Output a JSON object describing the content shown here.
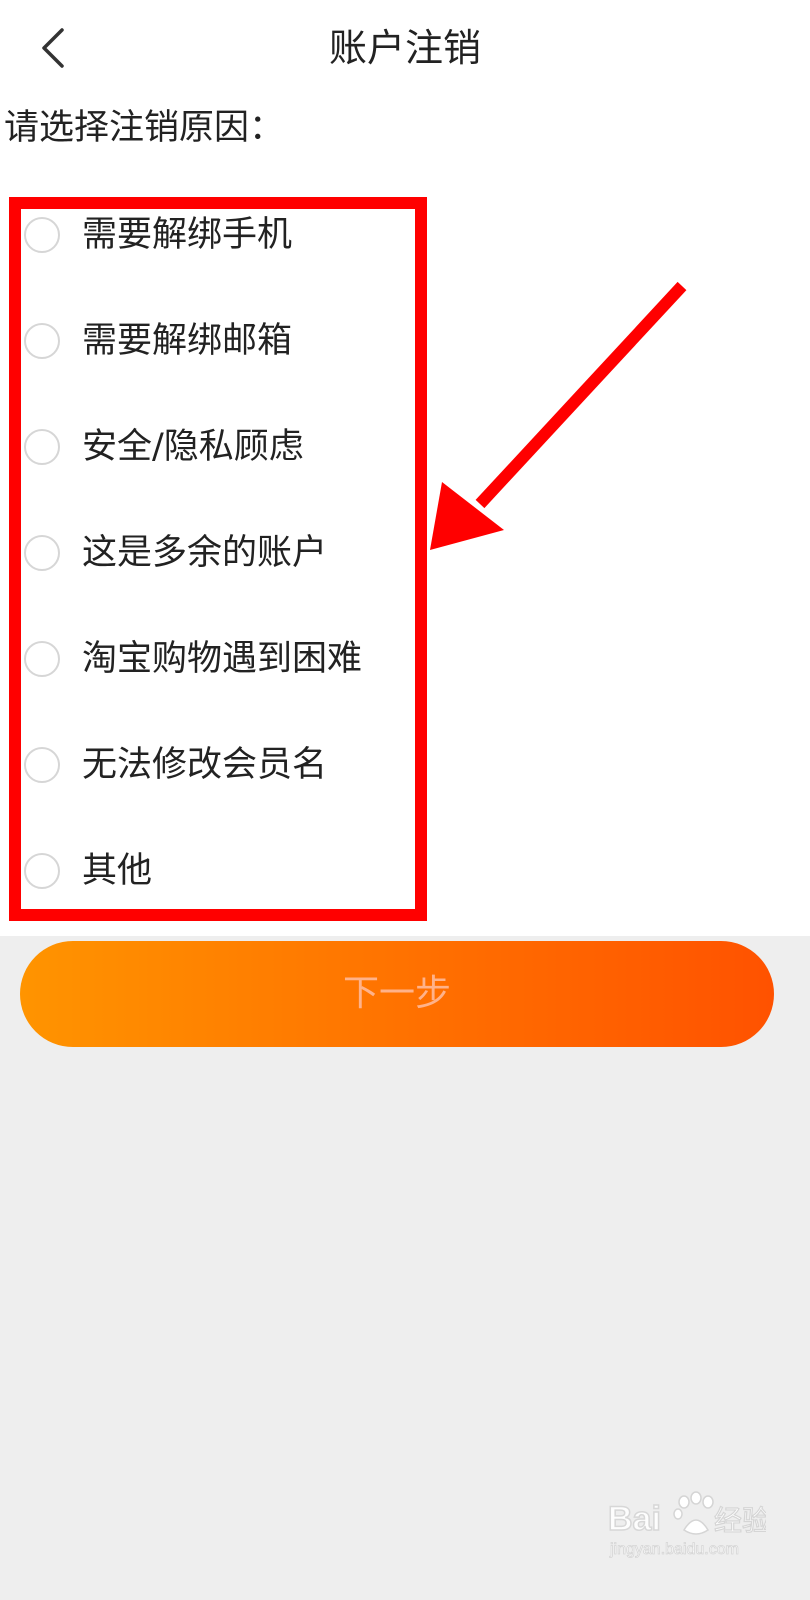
{
  "header": {
    "back_icon": "chevron-left-icon",
    "title": "账户注销"
  },
  "prompt": "请选择注销原因：",
  "reasons": [
    {
      "label": "需要解绑手机",
      "selected": false
    },
    {
      "label": "需要解绑邮箱",
      "selected": false
    },
    {
      "label": "安全/隐私顾虑",
      "selected": false
    },
    {
      "label": "这是多余的账户",
      "selected": false
    },
    {
      "label": "淘宝购物遇到困难",
      "selected": false
    },
    {
      "label": "无法修改会员名",
      "selected": false
    },
    {
      "label": "其他",
      "selected": false
    }
  ],
  "next_button": {
    "label": "下一步",
    "gradient_start": "#ff9400",
    "gradient_end": "#ff5200",
    "text_color": "#ffb28a"
  },
  "annotation": {
    "color": "#ff0000"
  },
  "watermark": {
    "brand": "Baidu经验",
    "url": "jingyan.baidu.com"
  },
  "colors": {
    "top_background": "#ffffff",
    "bottom_background": "#eeeeee",
    "radio_border": "#d6d6d6"
  }
}
